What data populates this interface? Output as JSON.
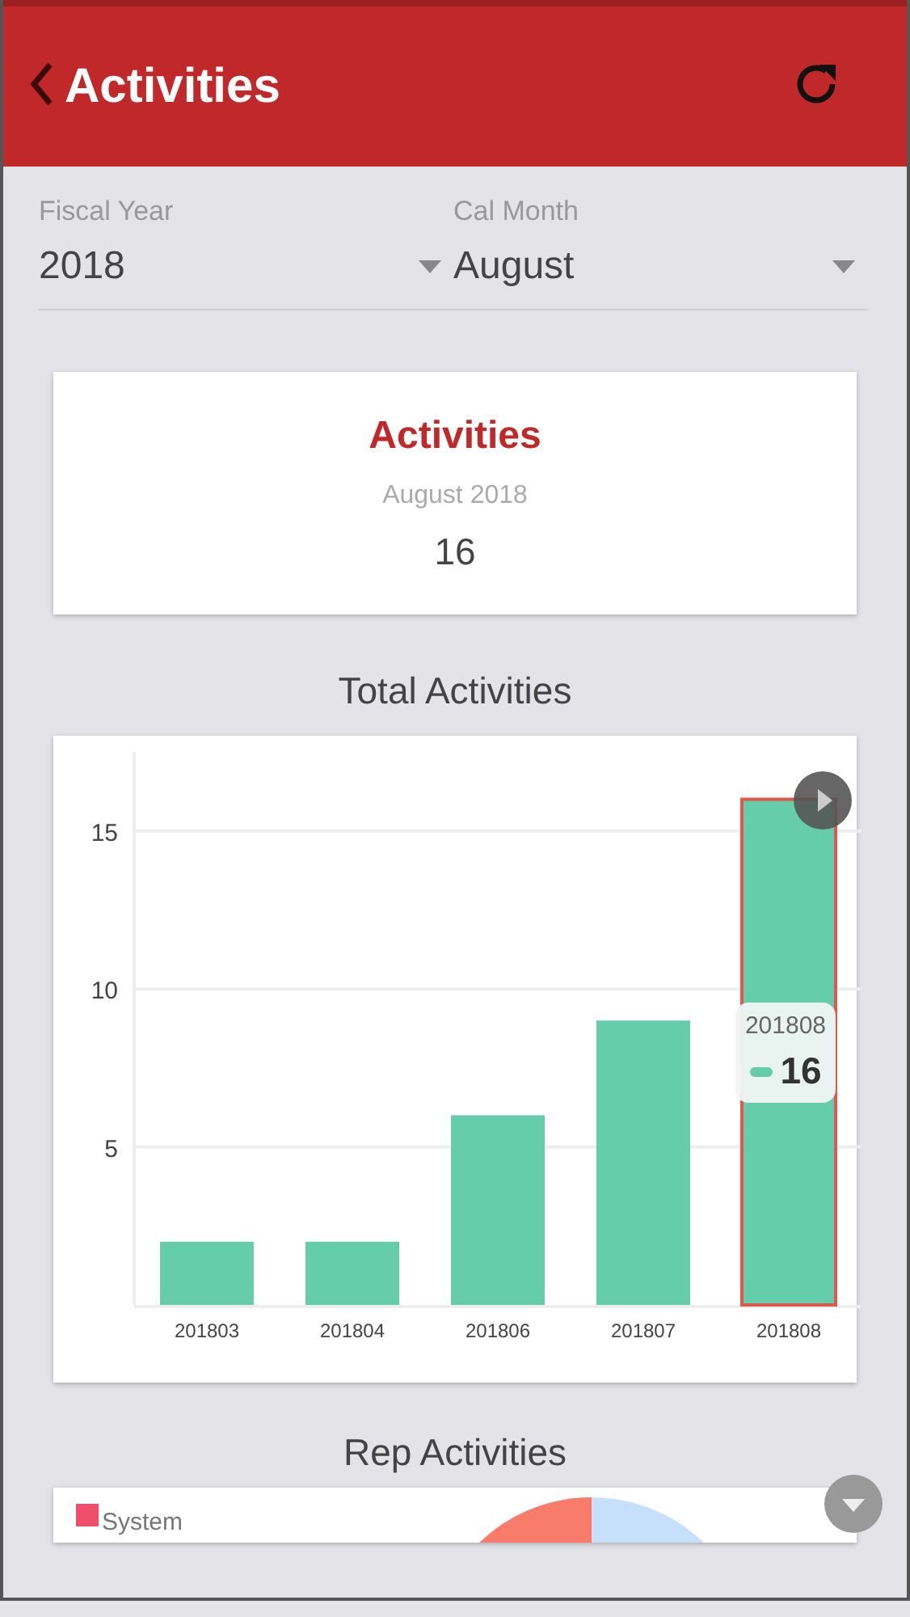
{
  "header": {
    "title": "Activities"
  },
  "filters": [
    {
      "label": "Fiscal Year",
      "value": "2018"
    },
    {
      "label": "Cal Month",
      "value": "August"
    }
  ],
  "summary": {
    "title": "Activities",
    "period": "August 2018",
    "value": "16"
  },
  "total_section": {
    "title": "Total Activities",
    "chart_data": {
      "type": "bar",
      "categories": [
        "201803",
        "201804",
        "201806",
        "201807",
        "201808"
      ],
      "series": [
        {
          "color": "#66cdaa",
          "values": [
            2,
            2,
            6,
            9,
            16
          ]
        }
      ],
      "ylim": [
        0,
        17.5
      ],
      "yticks": [
        5,
        10,
        15
      ],
      "grid": true
    },
    "bars": [
      {
        "selected": false
      },
      {
        "selected": false
      },
      {
        "selected": false
      },
      {
        "selected": false
      },
      {
        "selected": true
      }
    ],
    "tooltip": {
      "category": "201808",
      "value": "16"
    }
  },
  "rep_section": {
    "title": "Rep Activities",
    "legend": [
      {
        "label": "System",
        "color": "#f04e6a"
      }
    ]
  }
}
